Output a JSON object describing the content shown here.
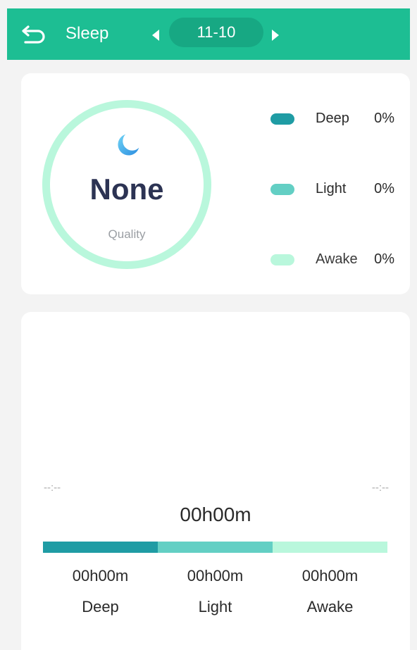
{
  "header": {
    "title": "Sleep",
    "date": "11-10",
    "background": "#1dbe93"
  },
  "summary": {
    "quality_value": "None",
    "quality_label": "Quality",
    "ring_color": "#b9f7dc",
    "legend": [
      {
        "name": "Deep",
        "pct": "0%",
        "color": "#1f9ca4"
      },
      {
        "name": "Light",
        "pct": "0%",
        "color": "#63cfc4"
      },
      {
        "name": "Awake",
        "pct": "0%",
        "color": "#b9f7dc"
      }
    ]
  },
  "detail": {
    "start_time": "--:--",
    "end_time": "--:--",
    "total": "00h00m",
    "segments": [
      {
        "label": "Deep",
        "time": "00h00m",
        "color": "#1f9ca4"
      },
      {
        "label": "Light",
        "time": "00h00m",
        "color": "#63cfc4"
      },
      {
        "label": "Awake",
        "time": "00h00m",
        "color": "#b9f7dc"
      }
    ]
  }
}
